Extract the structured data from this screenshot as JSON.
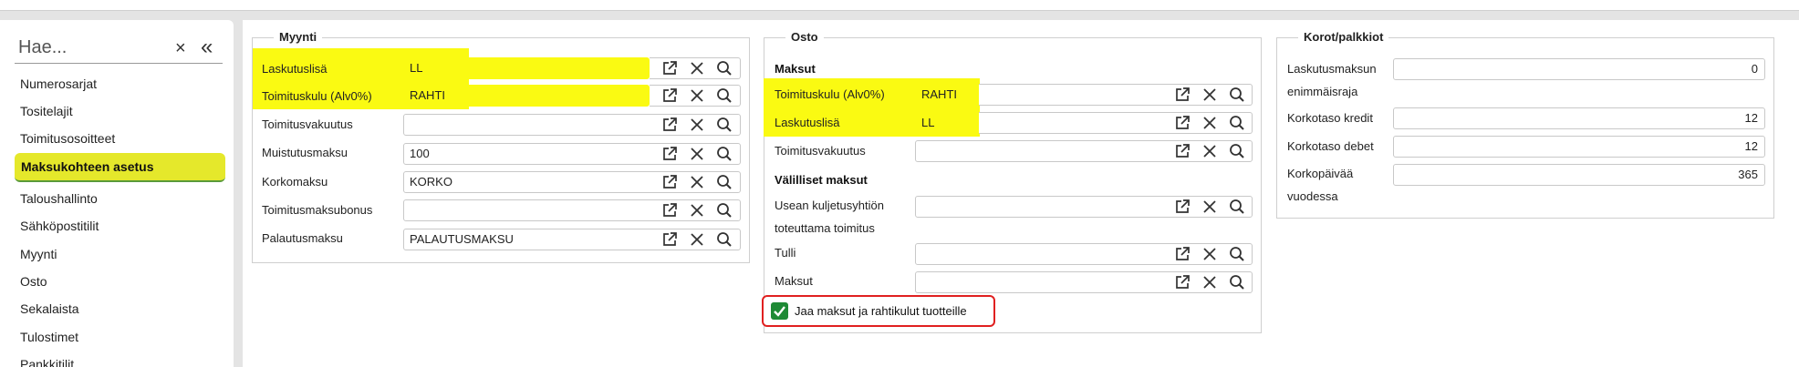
{
  "sidebar": {
    "search_placeholder": "Hae...",
    "clear_icon": "×",
    "collapse_icon": "«",
    "items": [
      "Numerosarjat",
      "Tositelajit",
      "Toimitusosoitteet",
      "Maksukohteen asetus",
      "Taloushallinto",
      "Sähköpostitilit",
      "Myynti",
      "Osto",
      "Sekalaista",
      "Tulostimet",
      "Pankkitilit"
    ],
    "active_index": 3,
    "active_color": "#e5e82b"
  },
  "myynti": {
    "title": "Myynti",
    "rows": [
      {
        "label": "Laskutuslisä",
        "value": "LL",
        "highlight": true
      },
      {
        "label": "Toimituskulu (Alv0%)",
        "value": "RAHTI",
        "highlight": true
      },
      {
        "label": "Toimitusvakuutus",
        "value": ""
      },
      {
        "label": "Muistutusmaksu",
        "value": "100"
      },
      {
        "label": "Korkomaksu",
        "value": "KORKO"
      },
      {
        "label": "Toimitusmaksubonus",
        "value": ""
      },
      {
        "label": "Palautusmaksu",
        "value": "PALAUTUSMAKSU"
      }
    ]
  },
  "osto": {
    "title": "Osto",
    "maksut_title": "Maksut",
    "rows": [
      {
        "label": "Toimituskulu (Alv0%)",
        "value": "RAHTI",
        "highlight": true
      },
      {
        "label": "Laskutuslisä",
        "value": "LL",
        "highlight": true
      },
      {
        "label": "Toimitusvakuutus",
        "value": ""
      }
    ],
    "valilliset_title": "Välilliset maksut",
    "valilliset_rows": [
      {
        "label_1": "Usean kuljetusyhtiön",
        "label_2": "toteuttama toimitus",
        "value": ""
      },
      {
        "label": "Tulli",
        "value": ""
      },
      {
        "label": "Maksut",
        "value": ""
      }
    ],
    "checkbox_label": "Jaa maksut ja rahtikulut tuotteille",
    "checkbox_checked": true
  },
  "korot": {
    "title": "Korot/palkkiot",
    "rows": [
      {
        "label_1": "Laskutusmaksun",
        "label_2": "enimmäisraja",
        "value": "0"
      },
      {
        "label": "Korkotaso kredit",
        "value": "12"
      },
      {
        "label": "Korkotaso debet",
        "value": "12"
      },
      {
        "label_1": "Korkopäivää",
        "label_2": "vuodessa",
        "value": "365"
      }
    ]
  },
  "icons": [
    "open-external-icon",
    "clear-icon",
    "search-icon"
  ],
  "colors": {
    "highlight": "#fafa12",
    "check": "#1e8a35",
    "alert_border": "#e02020"
  }
}
